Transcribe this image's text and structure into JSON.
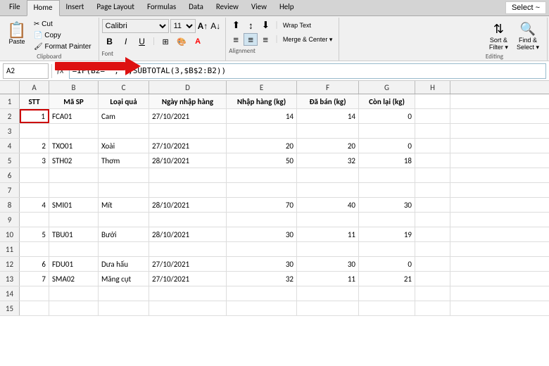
{
  "ribbon": {
    "tabs": [
      "File",
      "Home",
      "Insert",
      "Page Layout",
      "Formulas",
      "Data",
      "Review",
      "View",
      "Help"
    ],
    "active_tab": "Home",
    "font_name": "Calibri",
    "font_size": "11",
    "clipboard_label": "Clipboard",
    "font_label": "Font",
    "alignment_label": "Alignment",
    "editing_label": "Editing",
    "wrap_text": "Wrap Text",
    "merge_center": "Merge & Center",
    "sort_filter": "Sort & Filter",
    "find_select": "Find & Select",
    "select_btn": "Select ~"
  },
  "formula_bar": {
    "cell_ref": "A2",
    "formula": "=IF(B2=\"\",\"\",SUBTOTAL(3,$B$2:B2))"
  },
  "columns": {
    "headers": [
      "A",
      "B",
      "C",
      "D",
      "E",
      "F",
      "G",
      "H"
    ],
    "col1_header": "STT",
    "col2_header": "Mã SP",
    "col3_header": "Loại quả",
    "col4_header": "Ngày nhập hàng",
    "col5_header": "Nhập hàng (kg)",
    "col6_header": "Đã bán (kg)",
    "col7_header": "Còn lại (kg)"
  },
  "rows": [
    {
      "num": "1",
      "stt": "STT",
      "maSP": "Mã SP",
      "loaiQua": "Loại quả",
      "ngayNhap": "Ngày nhập hàng",
      "nhapHang": "Nhập hàng (kg)",
      "daBan": "Đã bán (kg)",
      "conLai": "Còn lại (kg)",
      "isHeader": true
    },
    {
      "num": "2",
      "stt": "1",
      "maSP": "FCA01",
      "loaiQua": "Cam",
      "ngayNhap": "27/10/2021",
      "nhapHang": "14",
      "daBan": "14",
      "conLai": "0",
      "isSelected": true
    },
    {
      "num": "3",
      "stt": "",
      "maSP": "",
      "loaiQua": "",
      "ngayNhap": "",
      "nhapHang": "",
      "daBan": "",
      "conLai": ""
    },
    {
      "num": "4",
      "stt": "2",
      "maSP": "TXO01",
      "loaiQua": "Xoài",
      "ngayNhap": "27/10/2021",
      "nhapHang": "20",
      "daBan": "20",
      "conLai": "0"
    },
    {
      "num": "5",
      "stt": "3",
      "maSP": "STH02",
      "loaiQua": "Thơm",
      "ngayNhap": "28/10/2021",
      "nhapHang": "50",
      "daBan": "32",
      "conLai": "18"
    },
    {
      "num": "6",
      "stt": "",
      "maSP": "",
      "loaiQua": "",
      "ngayNhap": "",
      "nhapHang": "",
      "daBan": "",
      "conLai": ""
    },
    {
      "num": "7",
      "stt": "",
      "maSP": "",
      "loaiQua": "",
      "ngayNhap": "",
      "nhapHang": "",
      "daBan": "",
      "conLai": ""
    },
    {
      "num": "8",
      "stt": "4",
      "maSP": "SMI01",
      "loaiQua": "Mít",
      "ngayNhap": "28/10/2021",
      "nhapHang": "70",
      "daBan": "40",
      "conLai": "30"
    },
    {
      "num": "9",
      "stt": "",
      "maSP": "",
      "loaiQua": "",
      "ngayNhap": "",
      "nhapHang": "",
      "daBan": "",
      "conLai": ""
    },
    {
      "num": "10",
      "stt": "5",
      "maSP": "TBU01",
      "loaiQua": "Bưởi",
      "ngayNhap": "28/10/2021",
      "nhapHang": "30",
      "daBan": "11",
      "conLai": "19"
    },
    {
      "num": "11",
      "stt": "",
      "maSP": "",
      "loaiQua": "",
      "ngayNhap": "",
      "nhapHang": "",
      "daBan": "",
      "conLai": ""
    },
    {
      "num": "12",
      "stt": "6",
      "maSP": "FDU01",
      "loaiQua": "Dưa hấu",
      "ngayNhap": "27/10/2021",
      "nhapHang": "30",
      "daBan": "30",
      "conLai": "0"
    },
    {
      "num": "13",
      "stt": "7",
      "maSP": "SMA02",
      "loaiQua": "Măng cụt",
      "ngayNhap": "27/10/2021",
      "nhapHang": "32",
      "daBan": "11",
      "conLai": "21"
    },
    {
      "num": "14",
      "stt": "",
      "maSP": "",
      "loaiQua": "",
      "ngayNhap": "",
      "nhapHang": "",
      "daBan": "",
      "conLai": ""
    },
    {
      "num": "15",
      "stt": "",
      "maSP": "",
      "loaiQua": "",
      "ngayNhap": "",
      "nhapHang": "",
      "daBan": "",
      "conLai": ""
    }
  ]
}
